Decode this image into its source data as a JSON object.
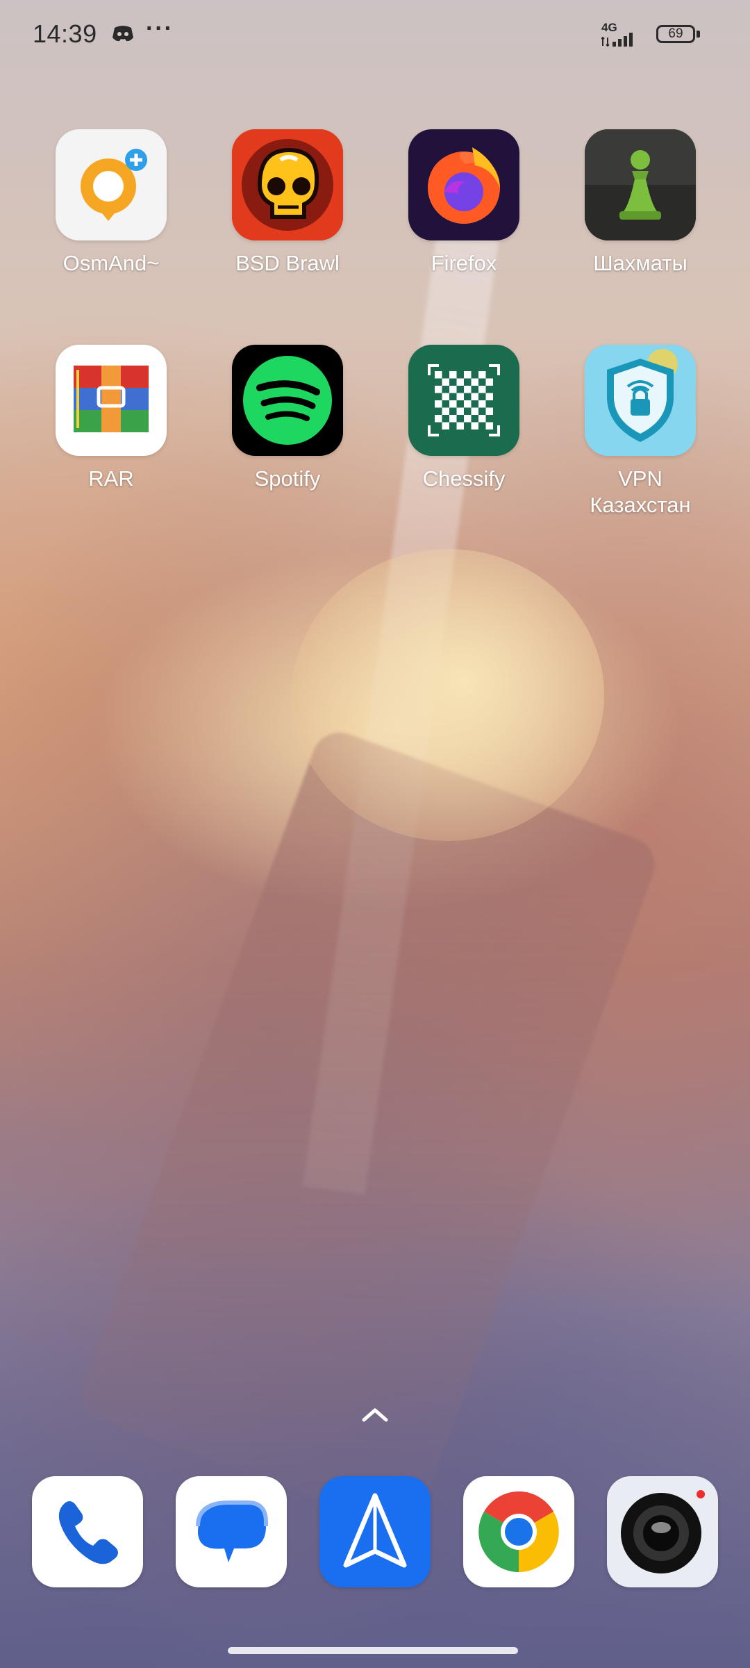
{
  "status_bar": {
    "time": "14:39",
    "network": "4G",
    "battery_level": "69",
    "notification_icons": [
      "discord-icon",
      "more-dots-icon"
    ]
  },
  "apps": [
    {
      "label": "OsmAnd~",
      "icon": "osmand-icon"
    },
    {
      "label": "BSD Brawl",
      "icon": "brawl-skull-icon"
    },
    {
      "label": "Firefox",
      "icon": "firefox-icon"
    },
    {
      "label": "Шахматы",
      "icon": "chess-pawn-icon"
    },
    {
      "label": "RAR",
      "icon": "rar-icon"
    },
    {
      "label": "Spotify",
      "icon": "spotify-icon"
    },
    {
      "label": "Chessify",
      "icon": "chessify-board-icon"
    },
    {
      "label": "VPN\nКазахстан",
      "icon": "vpn-shield-icon"
    }
  ],
  "dock": [
    {
      "app": "Phone",
      "icon": "phone-icon"
    },
    {
      "app": "Messages",
      "icon": "messages-icon"
    },
    {
      "app": "Navigator",
      "icon": "navigator-icon"
    },
    {
      "app": "Chrome",
      "icon": "chrome-icon"
    },
    {
      "app": "Camera",
      "icon": "camera-icon"
    }
  ],
  "colors": {
    "spotify_green": "#1ed760",
    "chessify_green": "#1b6b4f",
    "firefox_bg": "#20123a",
    "navigator_blue": "#1a6ef0",
    "status_text": "#2a2a2a"
  }
}
